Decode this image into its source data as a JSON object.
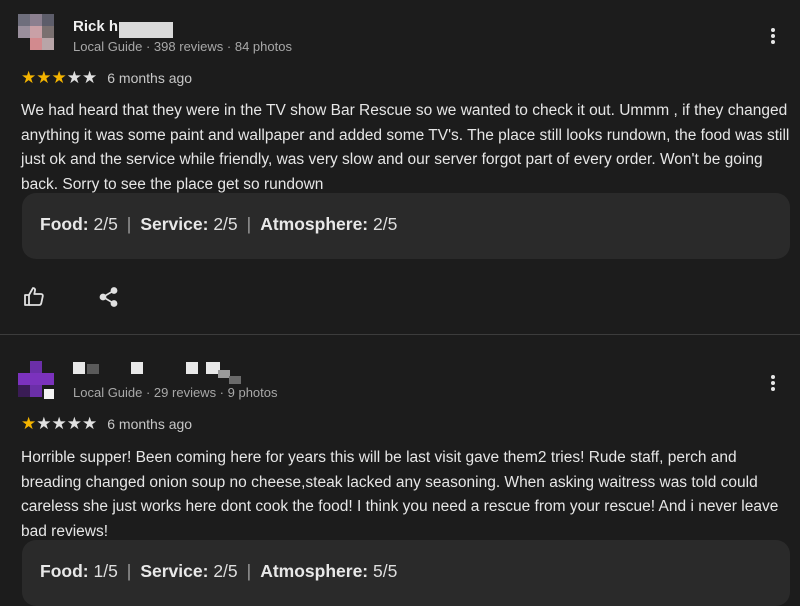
{
  "reviews": [
    {
      "reviewer_name": "Rick h",
      "reviewer_meta": "Local Guide · 398 reviews · 84 photos",
      "stars_filled": 3,
      "stars_total": 5,
      "time_ago": "6 months ago",
      "text": "We had heard that they were in the TV show Bar Rescue so we wanted to check it out. Ummm , if they changed anything it was some paint and wallpaper and added some TV's. The place still looks rundown, the food was still just ok and the service while friendly, was very slow and our server forgot part of every order. Won't be going back. Sorry to see the place get so rundown",
      "scores": {
        "food_label": "Food:",
        "food_value": "2/5",
        "service_label": "Service:",
        "service_value": "2/5",
        "atmosphere_label": "Atmosphere:",
        "atmosphere_value": "2/5"
      }
    },
    {
      "reviewer_name": "",
      "reviewer_meta": "Local Guide · 29 reviews · 9 photos",
      "stars_filled": 1,
      "stars_total": 5,
      "time_ago": "6 months ago",
      "text": "Horrible supper! Been coming here for years this will be last visit gave them2 tries! Rude staff, perch and breading changed onion soup no cheese,steak lacked any seasoning. When asking waitress was told could careless she just works here dont cook the food! I think you need a rescue from your rescue! And i never leave bad reviews!",
      "scores": {
        "food_label": "Food:",
        "food_value": "1/5",
        "service_label": "Service:",
        "service_value": "2/5",
        "atmosphere_label": "Atmosphere:",
        "atmosphere_value": "5/5"
      }
    }
  ],
  "colors": {
    "background": "#1c1c1c",
    "card": "#2a2a2a",
    "star": "#f4b400",
    "divider": "#3c3c3c"
  },
  "icons": [
    "thumbs-up-icon",
    "share-icon",
    "more-vert-icon"
  ]
}
